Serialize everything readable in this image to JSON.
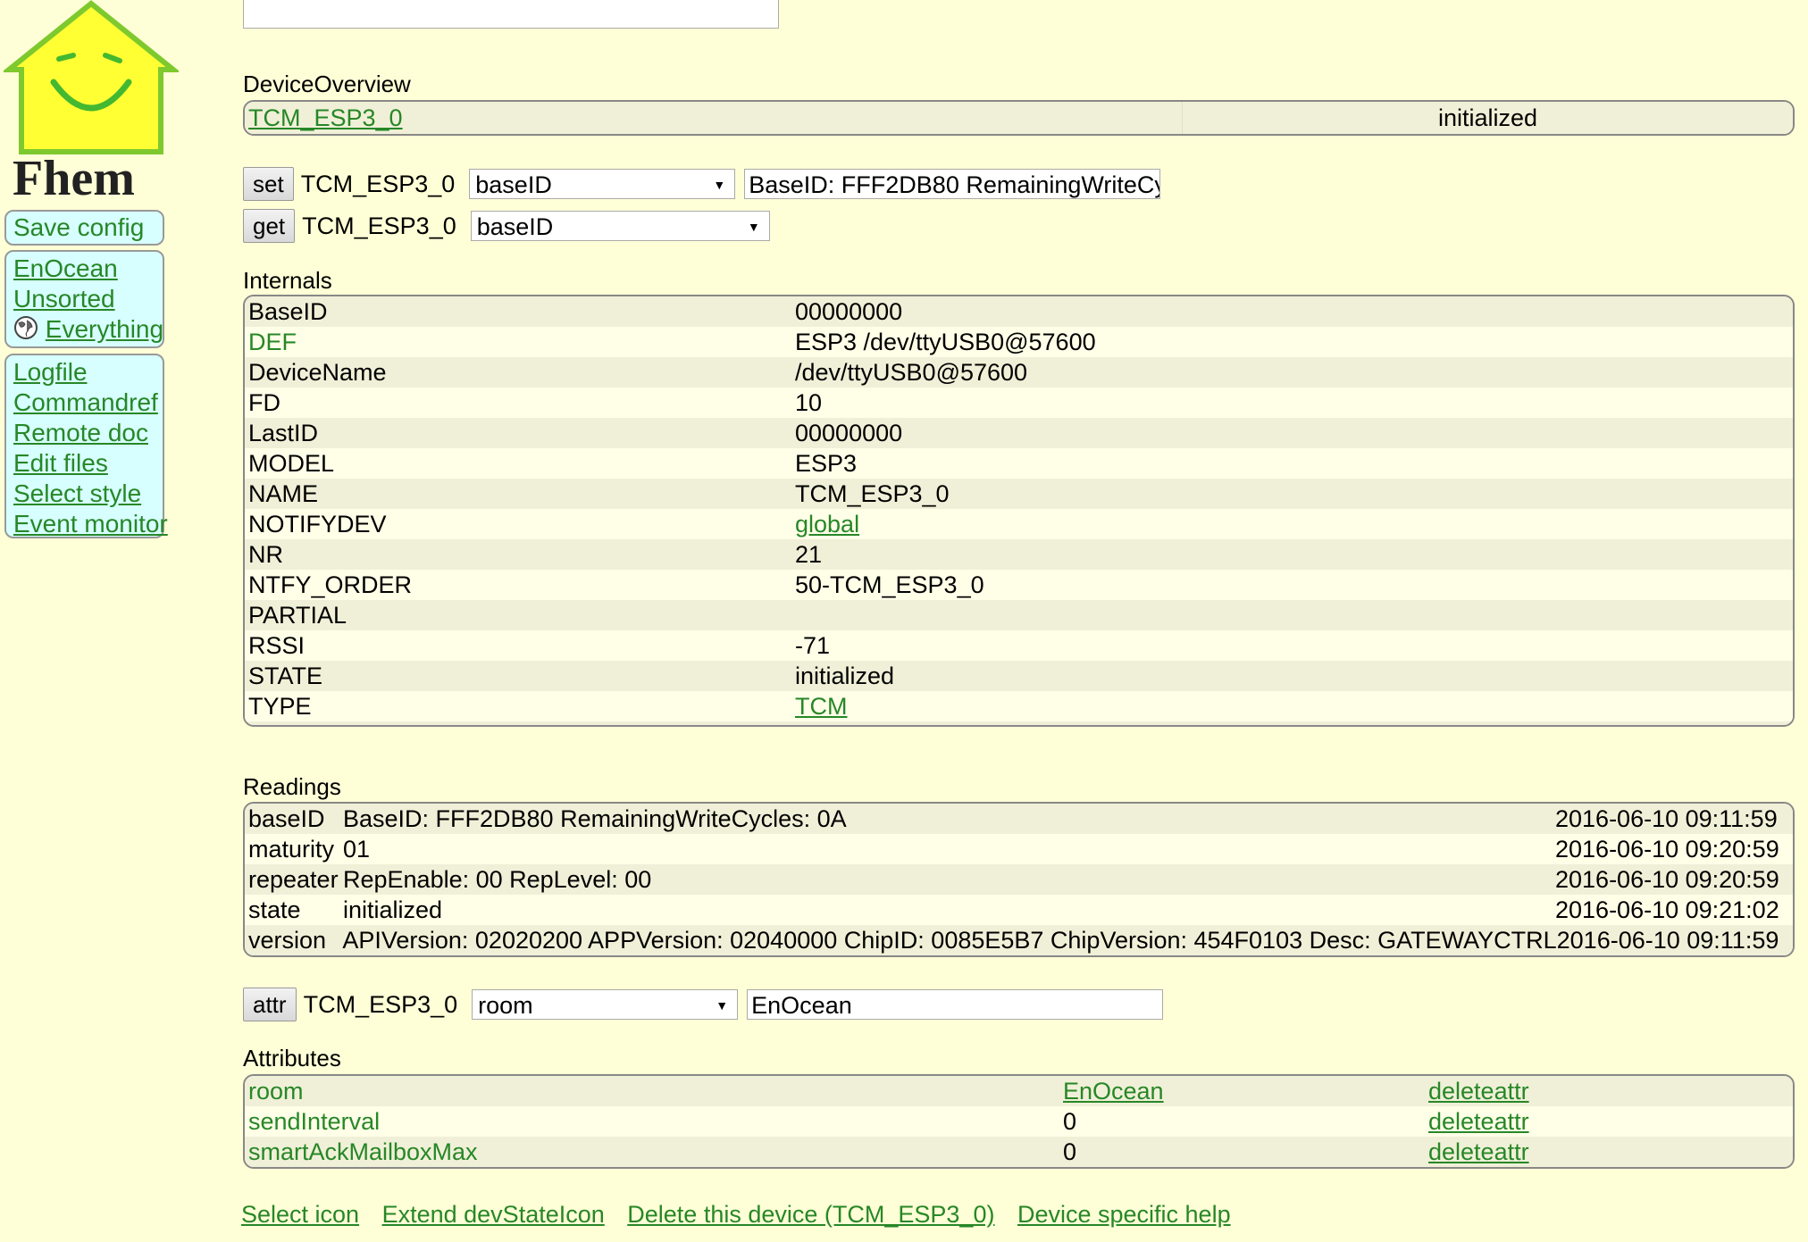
{
  "logo": {
    "text": "Fhem"
  },
  "menu": {
    "save": "Save config",
    "rooms": [
      "EnOcean",
      "Unsorted",
      "Everything"
    ],
    "help": [
      "Logfile",
      "Commandref",
      "Remote doc",
      "Edit files",
      "Select style",
      "Event monitor"
    ]
  },
  "overview": {
    "title": "DeviceOverview",
    "device": "TCM_ESP3_0",
    "state": "initialized"
  },
  "set_cmd": {
    "button": "set",
    "device": "TCM_ESP3_0",
    "select": "baseID",
    "value": "BaseID: FFF2DB80 RemainingWriteCy"
  },
  "get_cmd": {
    "button": "get",
    "device": "TCM_ESP3_0",
    "select": "baseID"
  },
  "internals": {
    "title": "Internals",
    "rows": [
      {
        "key": "BaseID",
        "value": "00000000"
      },
      {
        "key": "DEF",
        "value": "ESP3 /dev/ttyUSB0@57600"
      },
      {
        "key": "DeviceName",
        "value": "/dev/ttyUSB0@57600"
      },
      {
        "key": "FD",
        "value": "10"
      },
      {
        "key": "LastID",
        "value": "00000000"
      },
      {
        "key": "MODEL",
        "value": "ESP3"
      },
      {
        "key": "NAME",
        "value": "TCM_ESP3_0"
      },
      {
        "key": "NOTIFYDEV",
        "value": "global"
      },
      {
        "key": "NR",
        "value": "21"
      },
      {
        "key": "NTFY_ORDER",
        "value": "50-TCM_ESP3_0"
      },
      {
        "key": "PARTIAL",
        "value": ""
      },
      {
        "key": "RSSI",
        "value": "-71"
      },
      {
        "key": "STATE",
        "value": "initialized"
      },
      {
        "key": "TYPE",
        "value": "TCM"
      }
    ]
  },
  "readings": {
    "title": "Readings",
    "rows": [
      {
        "key": "baseID",
        "value": "BaseID: FFF2DB80 RemainingWriteCycles: 0A",
        "time": "2016-06-10 09:11:59"
      },
      {
        "key": "maturity",
        "value": "01",
        "time": "2016-06-10 09:20:59"
      },
      {
        "key": "repeater",
        "value": "RepEnable: 00 RepLevel: 00",
        "time": "2016-06-10 09:20:59"
      },
      {
        "key": "state",
        "value": "initialized",
        "time": "2016-06-10 09:21:02"
      },
      {
        "key": "version",
        "value": "APIVersion: 02020200 APPVersion: 02040000 ChipID: 0085E5B7 ChipVersion: 454F0103 Desc: GATEWAYCTRL",
        "time": "2016-06-10 09:11:59"
      }
    ]
  },
  "attr_cmd": {
    "button": "attr",
    "device": "TCM_ESP3_0",
    "select": "room",
    "value": "EnOcean"
  },
  "attributes": {
    "title": "Attributes",
    "rows": [
      {
        "key": "room",
        "value": "EnOcean",
        "action": "deleteattr"
      },
      {
        "key": "sendInterval",
        "value": "0",
        "action": "deleteattr"
      },
      {
        "key": "smartAckMailboxMax",
        "value": "0",
        "action": "deleteattr"
      }
    ]
  },
  "bottom_links": [
    "Select icon",
    "Extend devStateIcon",
    "Delete this device (TCM_ESP3_0)",
    "Device specific help"
  ]
}
